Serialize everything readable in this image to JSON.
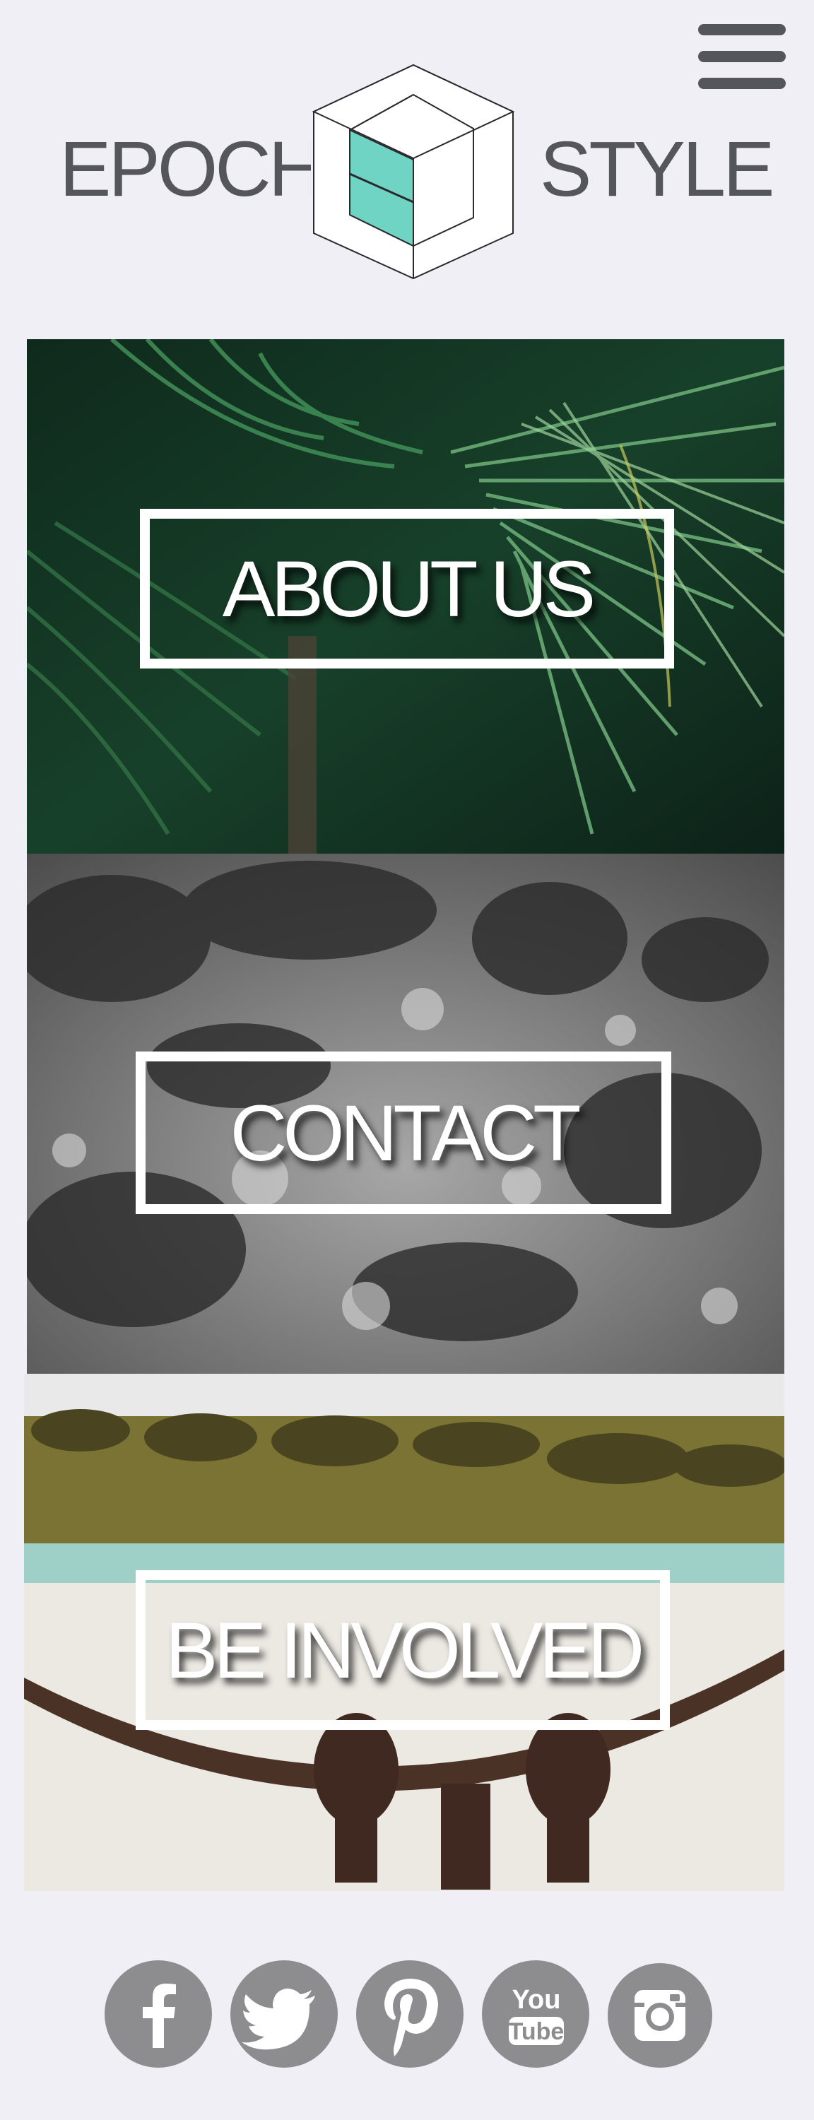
{
  "header": {
    "brand_left": "EPOCH",
    "brand_right": "STYLE",
    "menu_icon": "hamburger-menu-icon",
    "logo_icon": "cube-logo-icon",
    "accent_color": "#6fd4c4"
  },
  "panels": [
    {
      "label": "ABOUT US",
      "background": "palm-leaves-photo"
    },
    {
      "label": "CONTACT",
      "background": "moon-surface-photo"
    },
    {
      "label": "BE INVOLVED",
      "background": "beach-hammock-photo"
    }
  ],
  "social": [
    {
      "name": "facebook",
      "icon": "facebook-icon"
    },
    {
      "name": "twitter",
      "icon": "twitter-icon"
    },
    {
      "name": "pinterest",
      "icon": "pinterest-icon"
    },
    {
      "name": "youtube",
      "icon": "youtube-icon",
      "text_top": "You",
      "text_bottom": "Tube"
    },
    {
      "name": "instagram",
      "icon": "instagram-icon"
    }
  ],
  "colors": {
    "background": "#efeff5",
    "text_gray": "#55565c",
    "social_gray": "#8d8d8f"
  }
}
